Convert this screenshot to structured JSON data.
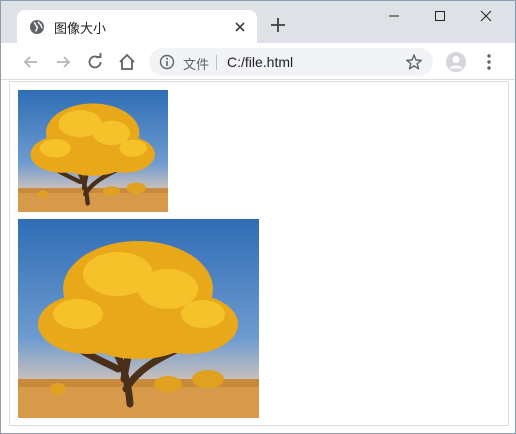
{
  "tab": {
    "title": "图像大小"
  },
  "omnibox": {
    "scheme_label": "文件",
    "url": "C:/file.html"
  },
  "icons": {
    "favicon": "globe-icon",
    "close_tab": "close-icon",
    "new_tab": "plus-icon",
    "back": "arrow-left-icon",
    "forward": "arrow-right-icon",
    "reload": "reload-icon",
    "home": "home-icon",
    "info": "info-icon",
    "bookmark": "star-icon",
    "profile": "avatar-icon",
    "menu": "kebab-menu-icon"
  },
  "content": {
    "images": [
      {
        "alt": "tree-photo-small",
        "size": "small"
      },
      {
        "alt": "tree-photo-large",
        "size": "large"
      }
    ]
  }
}
